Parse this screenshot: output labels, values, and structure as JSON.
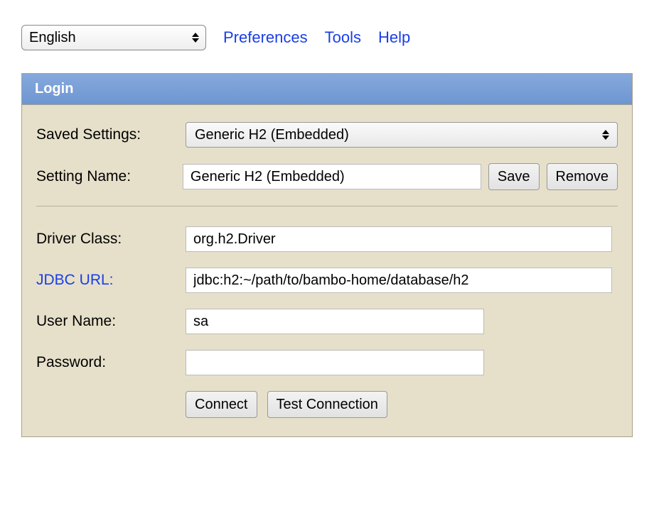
{
  "topbar": {
    "language_selected": "English",
    "links": {
      "preferences": "Preferences",
      "tools": "Tools",
      "help": "Help"
    }
  },
  "panel": {
    "title": "Login",
    "saved_settings_label": "Saved Settings:",
    "saved_settings_value": "Generic H2 (Embedded)",
    "setting_name_label": "Setting Name:",
    "setting_name_value": "Generic H2 (Embedded)",
    "save_button": "Save",
    "remove_button": "Remove",
    "driver_class_label": "Driver Class:",
    "driver_class_value": "org.h2.Driver",
    "jdbc_url_label": "JDBC URL:",
    "jdbc_url_value": "jdbc:h2:~/path/to/bambo-home/database/h2",
    "user_name_label": "User Name:",
    "user_name_value": "sa",
    "password_label": "Password:",
    "password_value": "",
    "connect_button": "Connect",
    "test_connection_button": "Test Connection"
  }
}
